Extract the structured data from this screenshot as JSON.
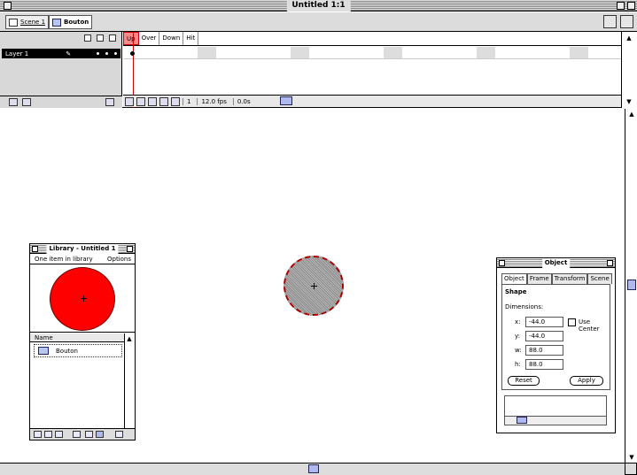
{
  "window": {
    "title": "Untitled 1:1"
  },
  "scenebar": {
    "scene_label": "Scene 1",
    "symbol_label": "Bouton"
  },
  "timeline": {
    "layer_name": "Layer 1",
    "states": [
      "Up",
      "Over",
      "Down",
      "Hit"
    ],
    "status": {
      "frame": "1",
      "fps": "12.0 fps",
      "time": "0.0s"
    }
  },
  "library": {
    "title": "Library - Untitled 1",
    "count_text": "One item in library",
    "options_label": "Options",
    "column_name": "Name",
    "items": [
      {
        "name": "Bouton"
      }
    ]
  },
  "inspector": {
    "title": "Object",
    "tabs": [
      "Object",
      "Frame",
      "Transform",
      "Scene"
    ],
    "section": "Shape",
    "dimensions_label": "Dimensions:",
    "x_label": "x:",
    "x_value": "-44.0",
    "y_label": "y:",
    "y_value": "-44.0",
    "w_label": "w:",
    "w_value": "88.0",
    "h_label": "h:",
    "h_value": "88.0",
    "use_center_label": "Use Center",
    "reset_label": "Reset",
    "apply_label": "Apply"
  },
  "colors": {
    "symbol_fill": "#fe0000",
    "up_state_highlight": "#f68a8a",
    "scroll_thumb": "#b0b8f0"
  }
}
